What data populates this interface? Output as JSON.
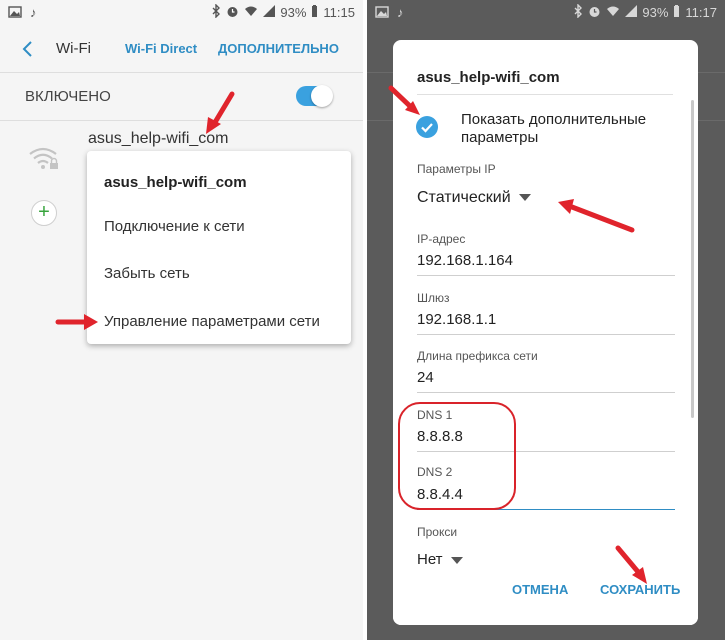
{
  "left": {
    "status_bar": {
      "battery": "93%",
      "time": "11:15"
    },
    "appbar": {
      "title": "Wi-Fi",
      "tab_direct": "Wi-Fi Direct",
      "tab_more": "ДОПОЛНИТЕЛЬНО"
    },
    "toggle": {
      "label": "ВКЛЮЧЕНО",
      "on": true
    },
    "network": {
      "name": "asus_help-wifi_com"
    },
    "popup": {
      "title": "asus_help-wifi_com",
      "items": [
        "Подключение к сети",
        "Забыть сеть",
        "Управление параметрами сети"
      ]
    }
  },
  "right": {
    "status_bar": {
      "battery": "93%",
      "time": "11:17"
    },
    "dialog": {
      "title": "asus_help-wifi_com",
      "show_advanced": "Показать дополнительные параметры",
      "ip_settings_label": "Параметры IP",
      "ip_settings_value": "Статический",
      "ip_label": "IP-адрес",
      "ip_value": "192.168.1.164",
      "gateway_label": "Шлюз",
      "gateway_value": "192.168.1.1",
      "prefix_label": "Длина префикса сети",
      "prefix_value": "24",
      "dns1_label": "DNS 1",
      "dns1_value": "8.8.8.8",
      "dns2_label": "DNS 2",
      "dns2_value": "8.8.4.4",
      "proxy_label": "Прокси",
      "proxy_value": "Нет",
      "cancel": "ОТМЕНА",
      "save": "СОХРАНИТЬ"
    }
  },
  "colors": {
    "accent": "#2f8dc4",
    "toggle": "#3aa1df",
    "annotation_red": "#e0242c",
    "dim": "#5b5b5b"
  }
}
